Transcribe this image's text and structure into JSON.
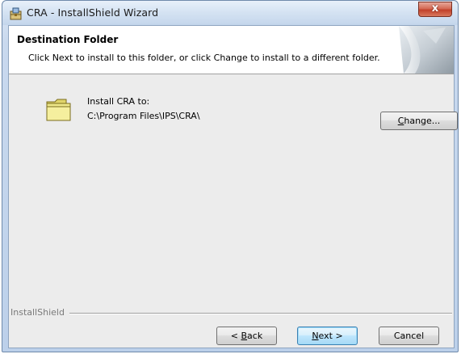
{
  "window": {
    "title": "CRA - InstallShield Wizard",
    "close_glyph": "x"
  },
  "header": {
    "title": "Destination Folder",
    "description": "Click Next to install to this folder, or click Change to install to a different folder."
  },
  "destination": {
    "label": "Install CRA to:",
    "path": "C:\\Program Files\\IPS\\CRA\\",
    "change_button": {
      "mnemonic": "C",
      "rest": "hange..."
    }
  },
  "footer": {
    "brand": "InstallShield",
    "back_button": {
      "prefix": "< ",
      "mnemonic": "B",
      "rest": "ack"
    },
    "next_button": {
      "mnemonic": "N",
      "rest": "ext >"
    },
    "cancel_button": "Cancel"
  },
  "icons": {
    "title": "installer-icon",
    "folder": "folder-icon",
    "header_art": "page-curl-icon"
  }
}
